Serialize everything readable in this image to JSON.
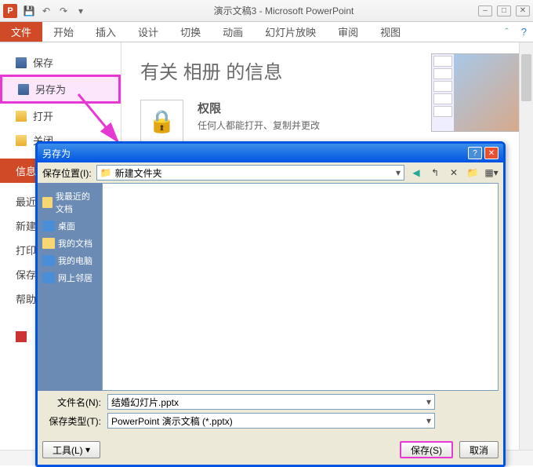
{
  "titlebar": {
    "app_letter": "P",
    "title": "演示文稿3 - Microsoft PowerPoint"
  },
  "ribbon": {
    "file": "文件",
    "tabs": [
      "开始",
      "插入",
      "设计",
      "切换",
      "动画",
      "幻灯片放映",
      "审阅",
      "视图"
    ]
  },
  "backstage": {
    "save": "保存",
    "save_as": "另存为",
    "open": "打开",
    "close": "关闭",
    "info": "信息",
    "recent": "最近…",
    "new": "新建",
    "print": "打印",
    "save_send": "保存…",
    "help": "帮助",
    "title": "有关 相册 的信息",
    "perm_heading": "权限",
    "perm_text": "任何人都能打开、复制并更改"
  },
  "dialog": {
    "title": "另存为",
    "location_label": "保存位置(I):",
    "location_value": "新建文件夹",
    "places": {
      "recent": "我最近的文档",
      "desktop": "桌面",
      "mydocs": "我的文档",
      "mycomputer": "我的电脑",
      "network": "网上邻居"
    },
    "filename_label": "文件名(N):",
    "filename_value": "结婚幻灯片.pptx",
    "filetype_label": "保存类型(T):",
    "filetype_value": "PowerPoint 演示文稿 (*.pptx)",
    "tools": "工具(L)",
    "save_btn": "保存(S)",
    "cancel_btn": "取消"
  }
}
